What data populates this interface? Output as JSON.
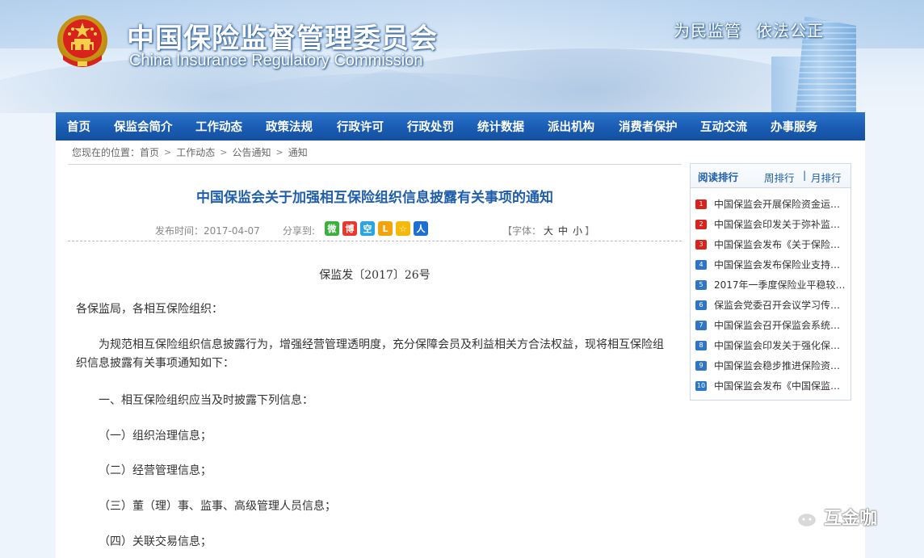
{
  "header": {
    "title_cn": "中国保险监督管理委员会",
    "title_en": "China Insurance Regulatory Commission",
    "slogan": [
      "为民监管",
      "依法公正"
    ]
  },
  "nav": {
    "items": [
      "首页",
      "保监会简介",
      "工作动态",
      "政策法规",
      "行政许可",
      "行政处罚",
      "统计数据",
      "派出机构",
      "消费者保护",
      "互动交流",
      "办事服务"
    ]
  },
  "breadcrumb": {
    "prefix": "您现在的位置：",
    "items": [
      "首页",
      "工作动态",
      "公告通知",
      "通知"
    ]
  },
  "article": {
    "title": "中国保监会关于加强相互保险组织信息披露有关事项的通知",
    "date_label": "发布时间：2017-04-07",
    "share_label": "分享到:",
    "share_icons": [
      "wechat-icon",
      "weibo-icon",
      "qzone-icon",
      "renren-icon",
      "qq-icon",
      "people-icon"
    ],
    "share_glyphs": [
      "微",
      "博",
      "空",
      "L",
      "☆",
      "人"
    ],
    "font_label_open": "【字体：",
    "font_sizes": [
      "大",
      "中",
      "小"
    ],
    "font_label_close": "】",
    "doc_number": "保监发〔2017〕26号",
    "greeting": "各保监局，各相互保险组织：",
    "intro": "为规范相互保险组织信息披露行为，增强经营管理透明度，充分保障会员及利益相关方合法权益，现将相互保险组织信息披露有关事项通知如下：",
    "lines": [
      "一、相互保险组织应当及时披露下列信息：",
      "（一）组织治理信息；",
      "（二）经营管理信息；",
      "（三）董（理）事、监事、高级管理人员信息；",
      "（四）关联交易信息；"
    ]
  },
  "ranking": {
    "tab_read": "阅读排行",
    "tab_week": "周排行",
    "tab_sep": "|",
    "tab_month": "月排行",
    "items": [
      {
        "rank": "1",
        "text": "中国保监会开展保险资金运…"
      },
      {
        "rank": "2",
        "text": "中国保监会印发关于弥补监…"
      },
      {
        "rank": "3",
        "text": "中国保监会发布《关于保险…"
      },
      {
        "rank": "4",
        "text": "中国保监会发布保险业支持…"
      },
      {
        "rank": "5",
        "text": "2017年一季度保险业平稳较…"
      },
      {
        "rank": "6",
        "text": "保监会党委召开会议学习传…"
      },
      {
        "rank": "7",
        "text": "中国保监会召开保监会系统…"
      },
      {
        "rank": "8",
        "text": "中国保监会印发关于强化保…"
      },
      {
        "rank": "9",
        "text": "中国保监会稳步推进保险资…"
      },
      {
        "rank": "10",
        "text": "中国保监会发布《中国保监…"
      }
    ]
  },
  "watermark": {
    "text": "互金咖"
  },
  "colors": {
    "nav_bg": "#1a5cb3",
    "title_blue": "#1f5ea8",
    "rank_red": "#d9221c",
    "rank_blue": "#2f76c6"
  }
}
